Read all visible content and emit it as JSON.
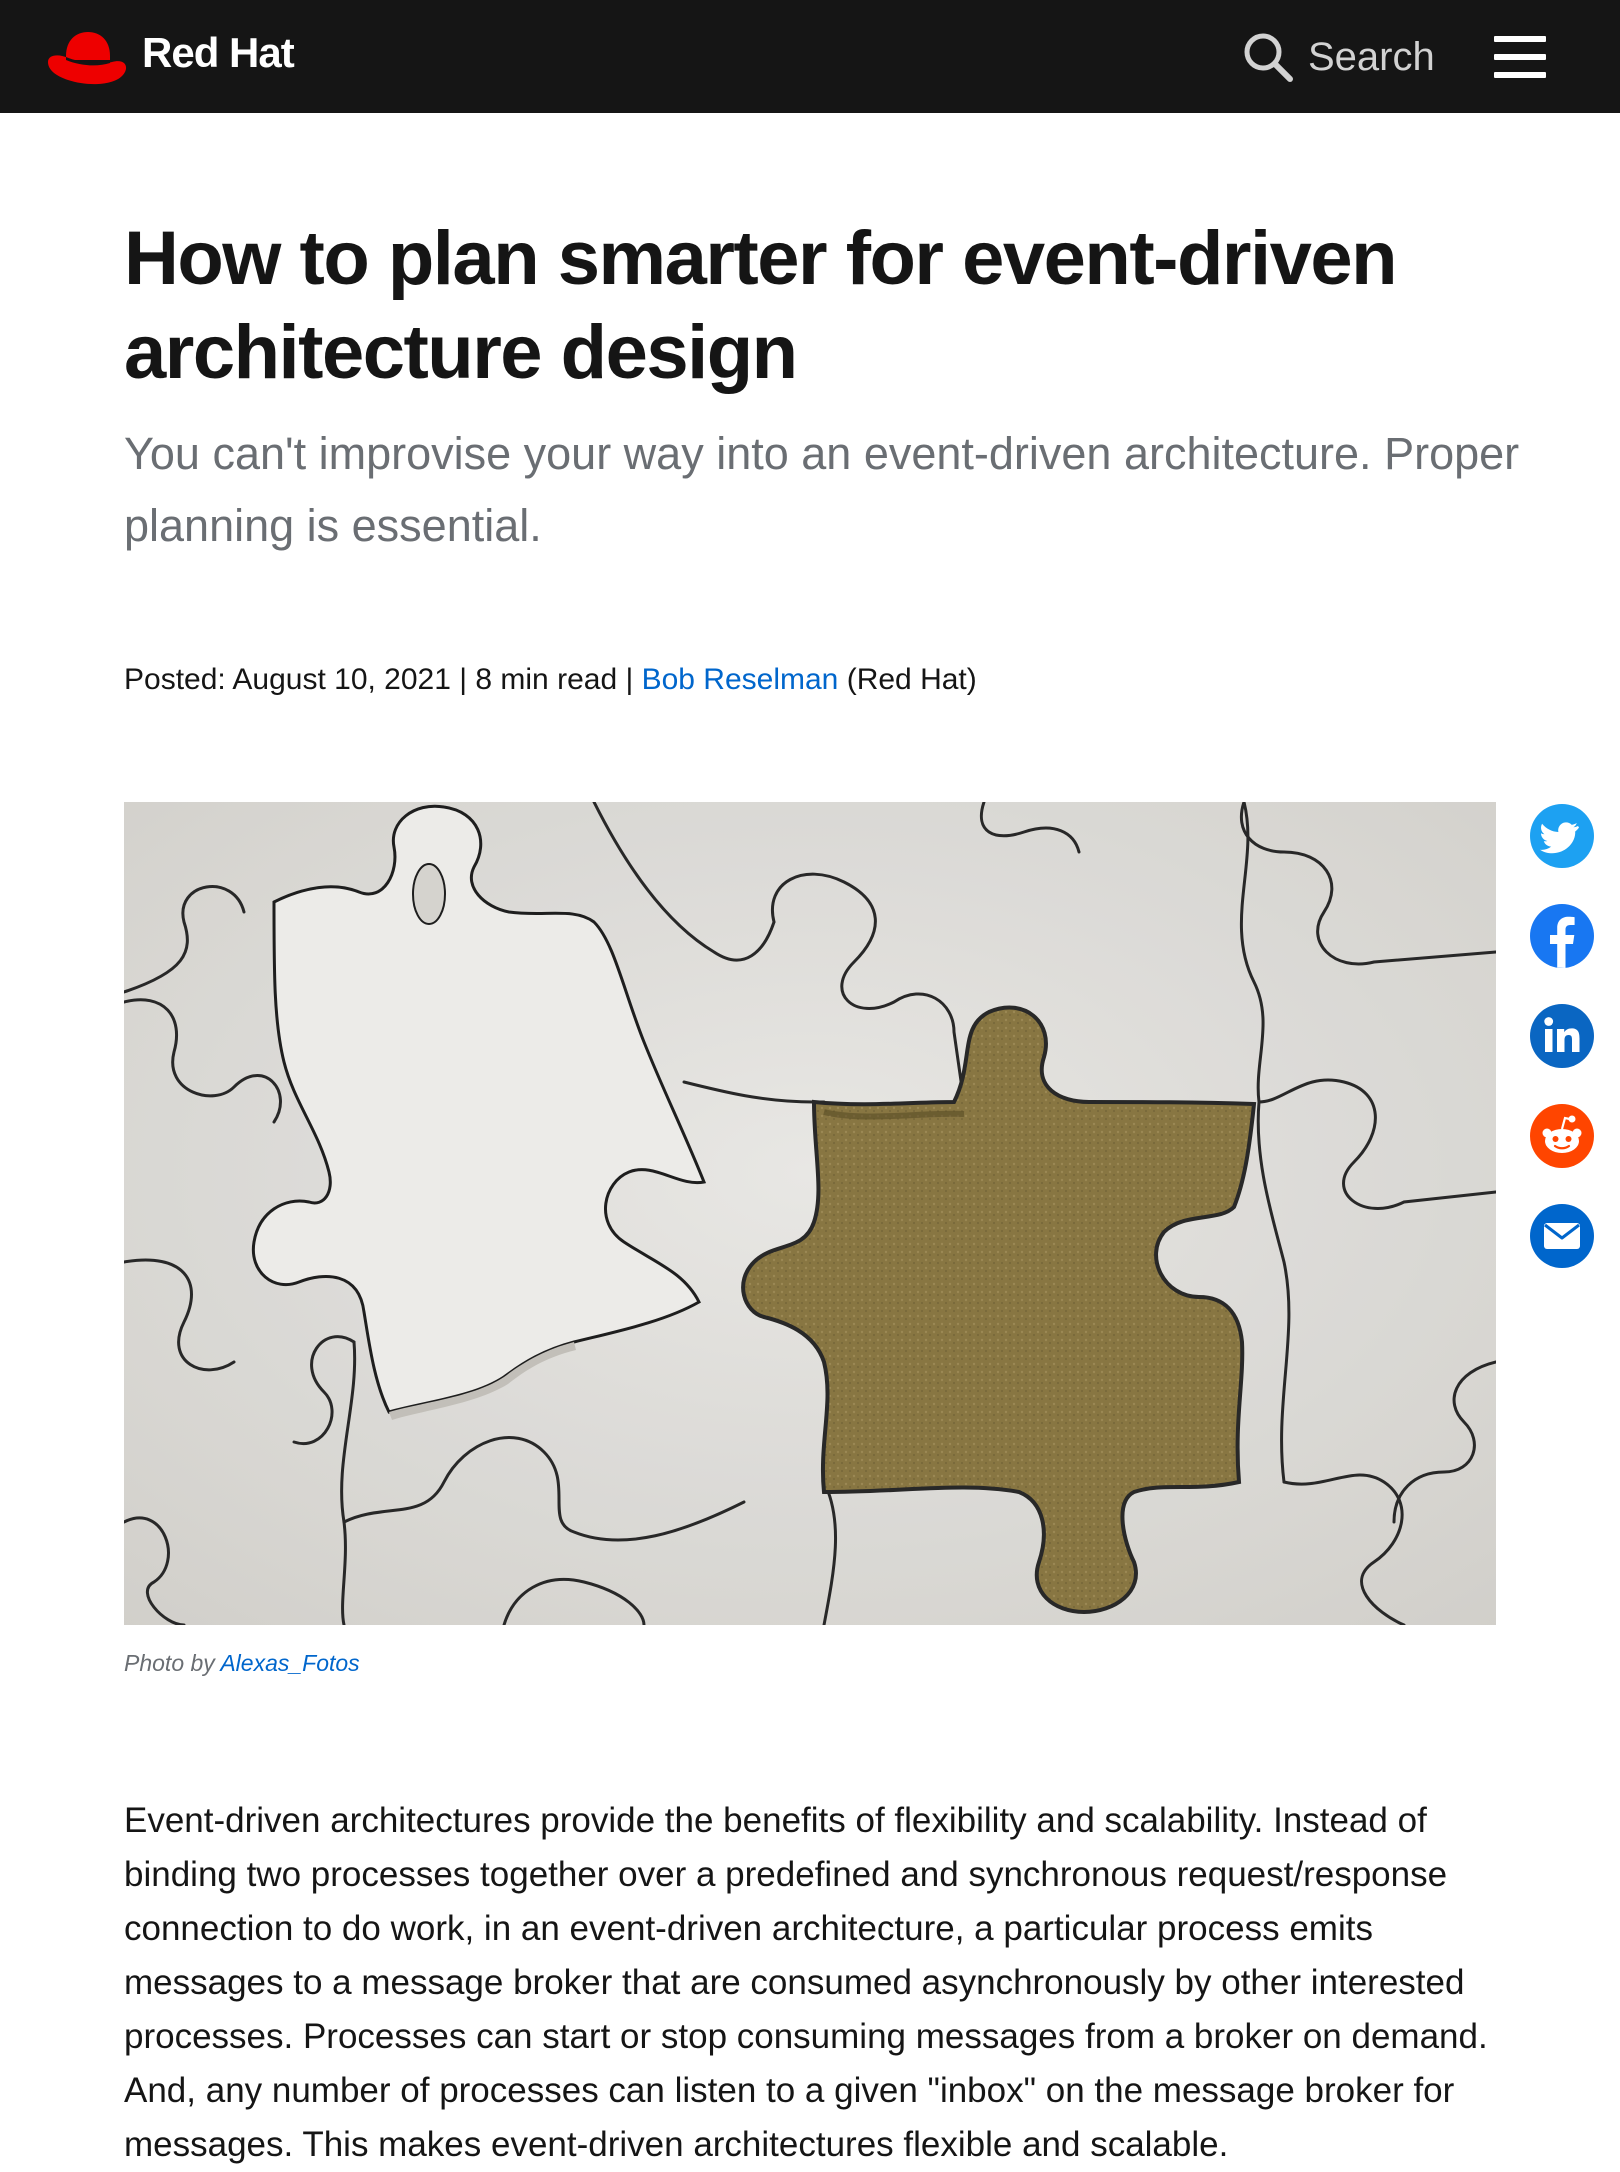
{
  "header": {
    "brand": "Red Hat",
    "search_label": "Search"
  },
  "article": {
    "title": "How to plan smarter for event-driven architecture design",
    "subtitle": "You can't improvise your way into an event-driven architecture. Proper planning is essential.",
    "meta": {
      "posted_prefix": "Posted: August 10, 2021 | 8 min read | ",
      "author": "Bob Reselman",
      "author_suffix": " (Red Hat)"
    },
    "image": {
      "caption_prefix": "Photo by ",
      "caption_author": "Alexas_Fotos"
    },
    "body": "Event-driven architectures provide the benefits of flexibility and scalability. Instead of binding two processes together over a predefined and synchronous request/response connection to do work, in an event-driven architecture, a particular process emits messages to a message broker that are consumed asynchronously by other interested processes. Processes can start or stop consuming messages from a broker on demand. And, any number of processes can listen to a given \"inbox\" on the message broker for messages. This makes event-driven architectures flexible and scalable."
  },
  "share": [
    {
      "network": "twitter",
      "icon": "twitter-icon",
      "color": "#1da1f2"
    },
    {
      "network": "facebook",
      "icon": "facebook-icon",
      "color": "#1877f2"
    },
    {
      "network": "linkedin",
      "icon": "linkedin-icon",
      "color": "#0a66c2"
    },
    {
      "network": "reddit",
      "icon": "reddit-icon",
      "color": "#ff4500"
    },
    {
      "network": "email",
      "icon": "email-icon",
      "color": "#0066cc"
    }
  ],
  "colors": {
    "brand_red": "#ee0000",
    "link": "#0066cc",
    "header_bg": "#151515"
  }
}
